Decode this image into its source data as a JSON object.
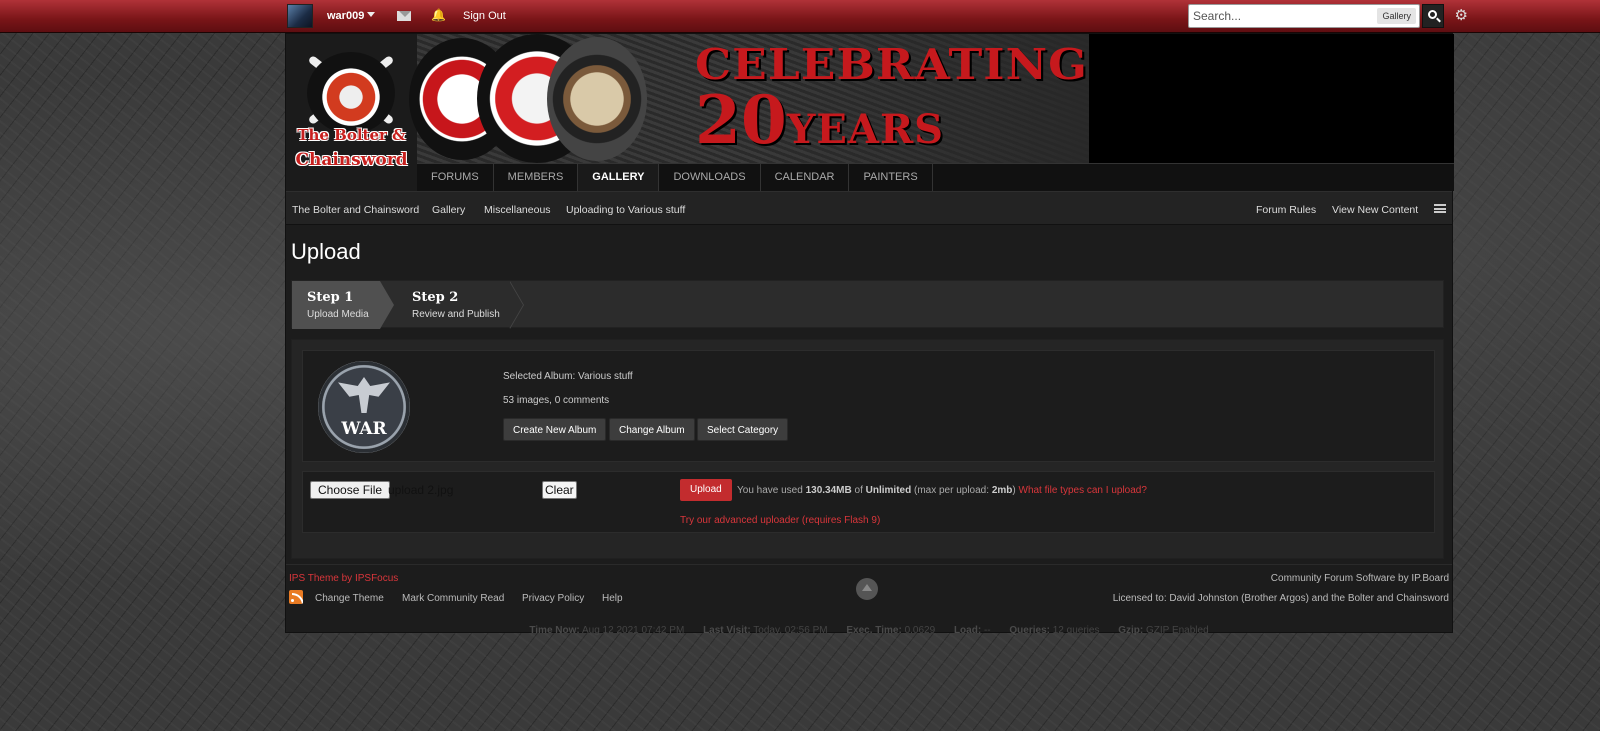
{
  "userbar": {
    "username": "war009",
    "sign_out": "Sign Out",
    "search_placeholder": "Search...",
    "search_scope": "Gallery"
  },
  "logo": {
    "line1": "The Bolter &",
    "line2": "Chainsword"
  },
  "banner": {
    "headline": "CELEBRATING",
    "number": "20",
    "suffix": "YEARS"
  },
  "main_nav": [
    {
      "label": "FORUMS"
    },
    {
      "label": "MEMBERS"
    },
    {
      "label": "GALLERY",
      "active": true
    },
    {
      "label": "DOWNLOADS"
    },
    {
      "label": "CALENDAR"
    },
    {
      "label": "PAINTERS"
    }
  ],
  "breadcrumbs": [
    "The Bolter and Chainsword",
    "Gallery",
    "Miscellaneous",
    "Uploading to Various stuff"
  ],
  "crumb_links": {
    "forum_rules": "Forum Rules",
    "view_new": "View New Content"
  },
  "page_title": "Upload",
  "steps": [
    {
      "title": "Step 1",
      "sub": "Upload Media",
      "active": true
    },
    {
      "title": "Step 2",
      "sub": "Review and Publish",
      "active": false
    }
  ],
  "album": {
    "avatar_text": "WAR",
    "selected": "Selected Album: Various stuff",
    "stats": "53 images, 0 comments",
    "buttons": {
      "create": "Create New Album",
      "change": "Change Album",
      "category": "Select Category"
    }
  },
  "uploader": {
    "choose_file": "Choose File",
    "file_name": "upload 2.jpg",
    "clear": "Clear",
    "upload": "Upload",
    "usage_prefix": "You have used",
    "used": "130.34MB",
    "of": "of",
    "limit": "Unlimited",
    "max_prefix": "(max per upload:",
    "max": "2mb",
    "max_suffix": ")",
    "file_types": "What file types can I upload?",
    "advanced": "Try our advanced uploader (requires Flash 9)"
  },
  "footer": {
    "theme_credit": "IPS Theme by IPSFocus",
    "links": {
      "change_theme": "Change Theme",
      "mark_read": "Mark Community Read",
      "privacy": "Privacy Policy",
      "help": "Help"
    },
    "software": "Community Forum Software by IP.Board",
    "license": "Licensed to: David Johnston (Brother Argos) and the Bolter and Chainsword",
    "stats": {
      "time_now_label": "Time Now:",
      "time_now": "Aug 12 2021 07:42 PM",
      "last_visit_label": "Last Visit:",
      "last_visit": "Today, 02:56 PM",
      "exec_label": "Exec. Time:",
      "exec": "0.0629",
      "load_label": "Load:",
      "load": "--",
      "queries_label": "Queries:",
      "queries": "12 queries",
      "gzip_label": "Gzip:",
      "gzip": "GZIP Enabled"
    }
  },
  "colors": {
    "accent": "#c32c2e",
    "link_red": "#d9363b",
    "topbar": "#8a1b1f"
  }
}
